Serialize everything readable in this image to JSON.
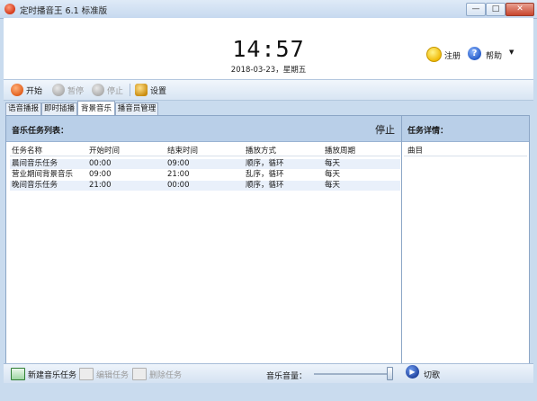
{
  "window": {
    "title": "定时播音王 6.1 标准版",
    "min_label": "—",
    "max_label": "□",
    "close_label": "✕"
  },
  "header": {
    "time": "14:57",
    "date": "2018-03-23，星期五",
    "register_label": "注册",
    "help_label": "帮助",
    "help_dropdown": "▼"
  },
  "toolbar": {
    "start_label": "开始",
    "pause_label": "暂停",
    "stop_label": "停止",
    "settings_label": "设置"
  },
  "tabs": [
    {
      "label": "语音播报"
    },
    {
      "label": "即时插播"
    },
    {
      "label": "背景音乐"
    },
    {
      "label": "播音员管理"
    }
  ],
  "task_list": {
    "title": "音乐任务列表：",
    "status": "停止",
    "columns": [
      "任务名称",
      "开始时间",
      "结束时间",
      "播放方式",
      "播放周期"
    ],
    "rows": [
      [
        "晨间音乐任务",
        "00:00",
        "09:00",
        "顺序，循环",
        "每天"
      ],
      [
        "营业期间背景音乐",
        "09:00",
        "21:00",
        "乱序，循环",
        "每天"
      ],
      [
        "晚间音乐任务",
        "21:00",
        "00:00",
        "顺序，循环",
        "每天"
      ]
    ]
  },
  "details": {
    "title": "任务详情：",
    "column": "曲目"
  },
  "bottom": {
    "new_task_label": "新建音乐任务",
    "edit_task_label": "编辑任务",
    "delete_task_label": "删除任务",
    "volume_label": "音乐音量：",
    "volume_level": 0.98,
    "switch_label": "切歌"
  },
  "colors": {
    "accent": "#2157c5",
    "header_band": "#b9cfe8",
    "row_alt": "#e9f0fa",
    "start_icon": "#e05a17"
  },
  "icons": [
    "app-icon",
    "play-icon",
    "pause-icon",
    "stop-icon",
    "settings-icon",
    "smiley-icon",
    "help-icon",
    "add-task-icon",
    "edit-task-icon",
    "delete-task-icon",
    "next-song-icon"
  ]
}
